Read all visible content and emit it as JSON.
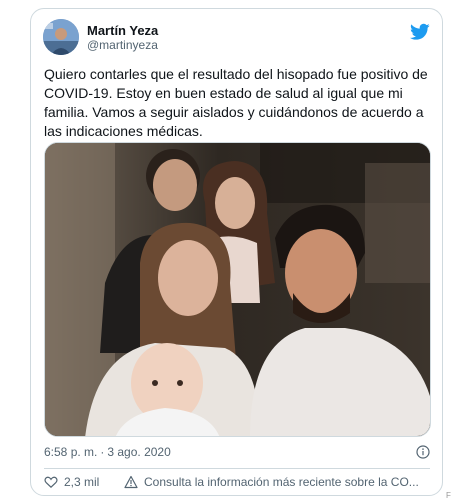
{
  "tweet": {
    "author_name": "Martín Yeza",
    "author_handle": "@martinyeza",
    "text": "Quiero contarles que el resultado del hisopado fue positivo de COVID-19. Estoy en buen estado de salud al igual que mi familia. Vamos a seguir aislados y cuidándonos de acuerdo a las indicaciones médicas.",
    "time": "6:58 p. m.",
    "separator": "·",
    "date": "3 ago. 2020",
    "like_count": "2,3 mil",
    "info_link": "Consulta la información más reciente sobre la CO..."
  },
  "icons": {
    "brand": "twitter-bird-icon",
    "info": "info-icon",
    "like": "heart-icon",
    "info_link": "alert-icon"
  },
  "colors": {
    "twitter_blue": "#1d9bf0",
    "secondary_text": "#536471",
    "border": "#cfd9de"
  },
  "stray_char": "F"
}
